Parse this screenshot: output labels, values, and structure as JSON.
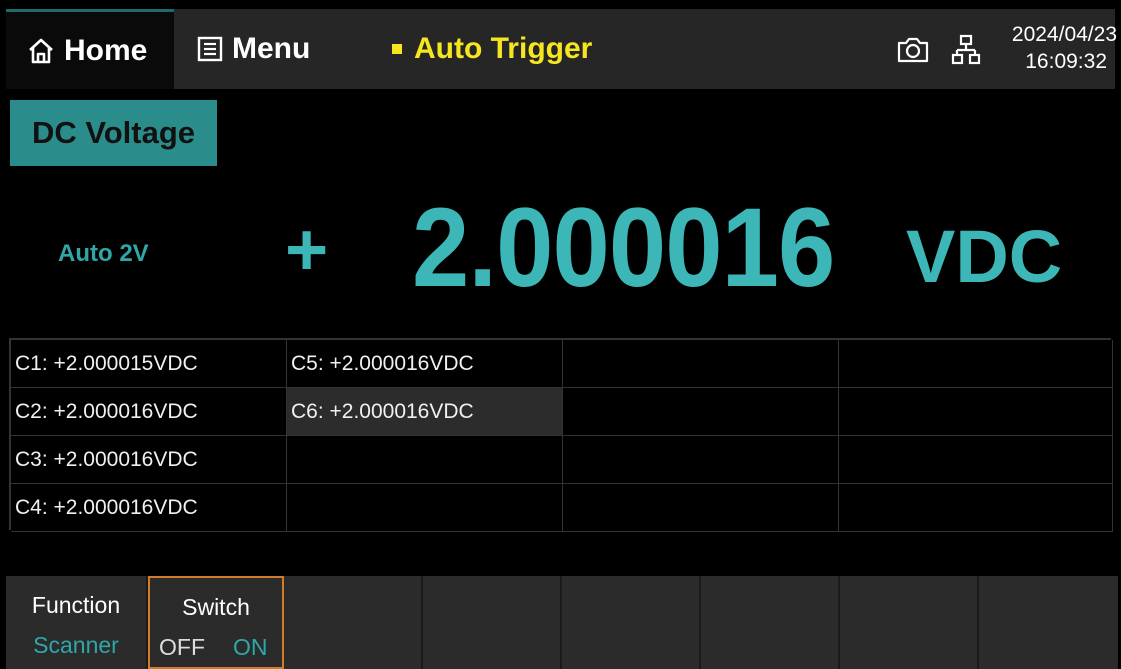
{
  "topbar": {
    "home_label": "Home",
    "menu_label": "Menu",
    "trigger_label": "Auto Trigger",
    "date": "2024/04/23",
    "time": "16:09:32",
    "colors": {
      "trigger": "#f6e620",
      "accent": "#2a8d8b"
    }
  },
  "icons": [
    "home-icon",
    "menu-list-icon",
    "camera-icon",
    "network-icon"
  ],
  "measurement": {
    "function": "DC Voltage",
    "range": "Auto 2V",
    "sign": "+",
    "value": "2.000016",
    "unit": "VDC"
  },
  "channels": {
    "c1": "C1: +2.000015VDC",
    "c2": "C2: +2.000016VDC",
    "c3": "C3: +2.000016VDC",
    "c4": "C4: +2.000016VDC",
    "c5": "C5: +2.000016VDC",
    "c6": "C6: +2.000016VDC"
  },
  "softkeys": {
    "function_title": "Function",
    "function_value": "Scanner",
    "switch_title": "Switch",
    "switch_off": "OFF",
    "switch_on": "ON"
  }
}
